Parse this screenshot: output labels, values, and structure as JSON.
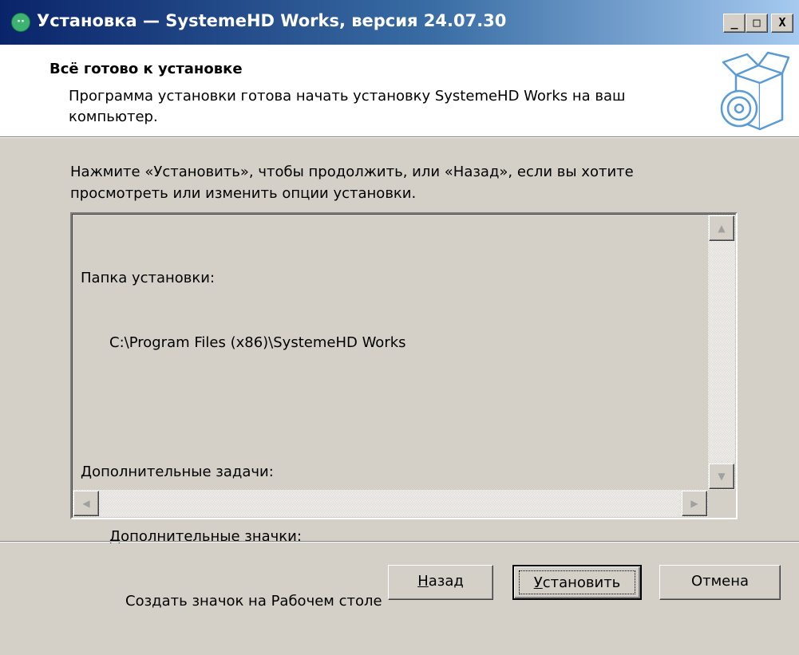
{
  "window": {
    "title": "Установка — SystemeHD Works, версия 24.07.30",
    "controls": {
      "minimize": "_",
      "maximize": "□",
      "close": "X"
    }
  },
  "header": {
    "title": "Всё готово к установке",
    "description": "Программа установки готова начать установку SystemeHD Works на ваш компьютер."
  },
  "instruction": "Нажмите «Установить», чтобы продолжить, или «Назад», если вы хотите просмотреть или изменить опции установки.",
  "memo": {
    "install_folder_label": "Папка установки:",
    "install_folder_path": "C:\\Program Files (x86)\\SystemeHD Works",
    "tasks_label": "Дополнительные задачи:",
    "icons_label": "Дополнительные значки:",
    "desktop_icon_task": "Создать значок на Рабочем столе"
  },
  "buttons": {
    "back_hotkey": "Н",
    "back_rest": "азад",
    "install_hotkey": "У",
    "install_rest": "становить",
    "cancel": "Отмена"
  },
  "icons": {
    "app": "app-logo-icon",
    "header": "software-box-icon"
  }
}
